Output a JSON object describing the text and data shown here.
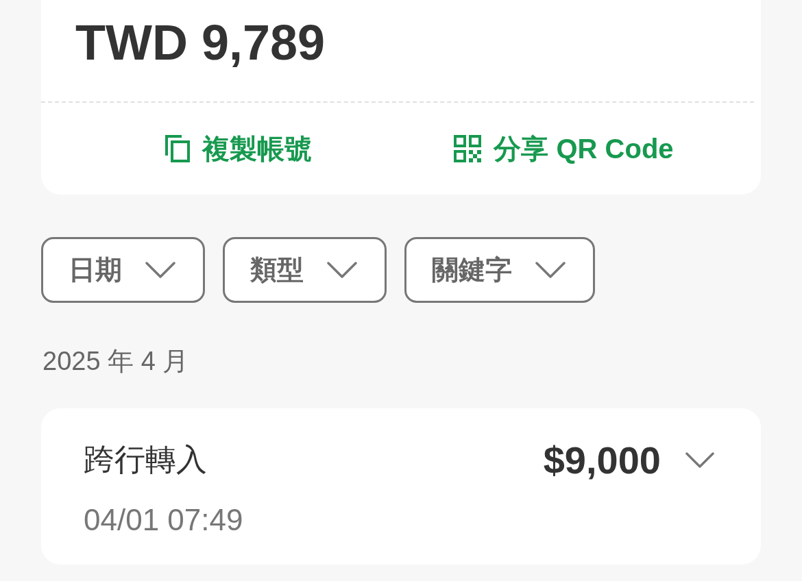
{
  "account_card": {
    "balance": "TWD 9,789",
    "actions": [
      {
        "kind": "copy",
        "label": "複製帳號"
      },
      {
        "kind": "qr",
        "label": "分享 QR Code"
      }
    ]
  },
  "filters": [
    {
      "label": "日期"
    },
    {
      "label": "類型"
    },
    {
      "label": "關鍵字"
    }
  ],
  "month_label": "2025 年 4 月",
  "transactions": [
    {
      "title": "跨行轉入",
      "amount": "$9,000",
      "time": "04/01 07:49",
      "expanded": false
    }
  ]
}
